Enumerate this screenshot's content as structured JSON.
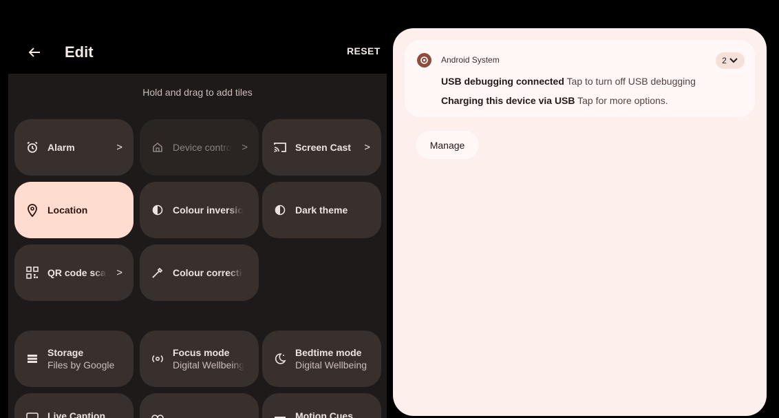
{
  "header": {
    "title": "Edit",
    "reset_label": "RESET",
    "back_icon": "arrow-left-icon"
  },
  "edit_panel": {
    "hint": "Hold and drag to add tiles"
  },
  "tiles": [
    {
      "label": "Alarm",
      "icon": "alarm-icon",
      "chevron": ">"
    },
    {
      "label": "Device controls",
      "icon": "home-icon",
      "chevron": ">"
    },
    {
      "label": "Screen Cast",
      "icon": "cast-icon",
      "chevron": ">"
    },
    {
      "label": "Location",
      "icon": "location-pin-icon"
    },
    {
      "label": "Colour inversion",
      "icon": "half-circle-icon"
    },
    {
      "label": "Dark theme",
      "icon": "half-circle-icon"
    },
    {
      "label": "QR code scanner",
      "icon": "qr-code-icon",
      "chevron": ">"
    },
    {
      "label": "Colour correction",
      "icon": "eyedropper-icon"
    }
  ],
  "available_tiles": [
    {
      "label": "Storage",
      "sublabel": "Files by Google",
      "icon": "storage-icon"
    },
    {
      "label": "Focus mode",
      "sublabel": "Digital Wellbeing",
      "icon": "focus-icon"
    },
    {
      "label": "Bedtime mode",
      "sublabel": "Digital Wellbeing",
      "icon": "moon-icon"
    },
    {
      "label": "Live Caption",
      "icon": "caption-icon"
    },
    {
      "label": "",
      "icon": "hearing-icon"
    },
    {
      "label": "Motion Cues",
      "icon": "motion-icon"
    }
  ],
  "notification": {
    "app_name": "Android System",
    "app_icon": "android-system-gear-icon",
    "count": "2",
    "lines": [
      {
        "title": "USB debugging connected",
        "text": "Tap to turn off USB debugging"
      },
      {
        "title": "Charging this device via USB",
        "text": "Tap for more options."
      }
    ]
  },
  "shade": {
    "manage_label": "Manage"
  },
  "colors": {
    "accent_tile": "#ffdbd0",
    "shade_bg": "#fdefec",
    "app_icon_bg": "#8c4d3f"
  }
}
